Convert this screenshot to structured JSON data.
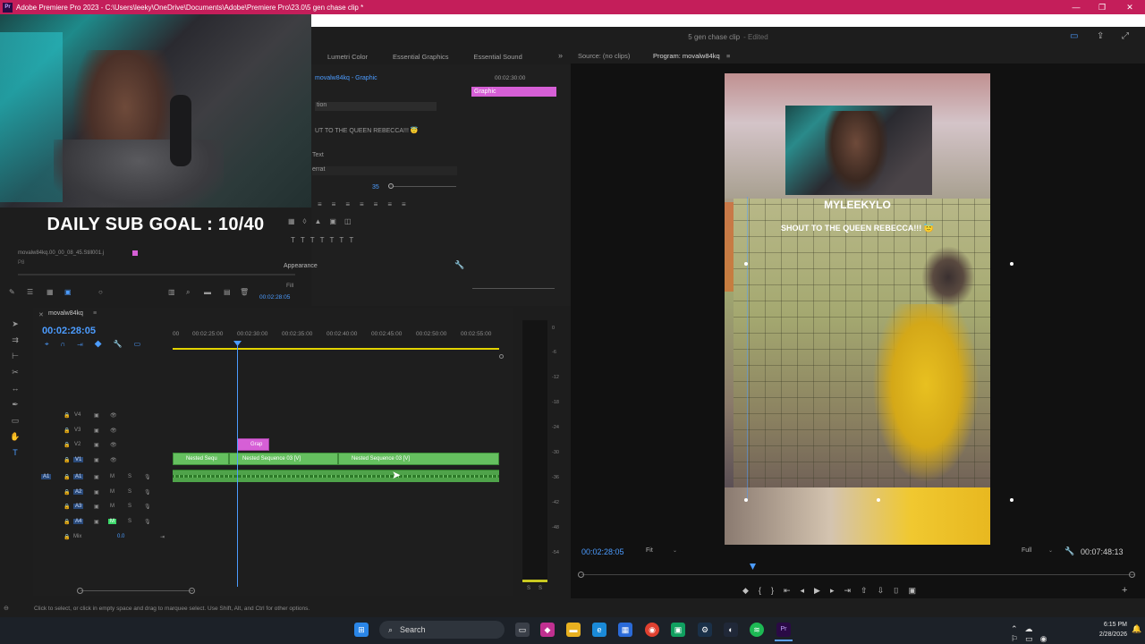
{
  "window": {
    "app_badge": "Pr",
    "title": "Adobe Premiere Pro 2023 - C:\\Users\\leeky\\OneDrive\\Documents\\Adobe\\Premiere Pro\\23.0\\5 gen chase clip *",
    "controls": [
      "—",
      "❐",
      "✕"
    ]
  },
  "document": {
    "name": "5 gen chase clip",
    "state": "- Edited"
  },
  "overlay": {
    "sub_goal": "DAILY SUB GOAL : 10/40"
  },
  "media": {
    "source_label": "movalw84kq.00_00_08_45.Still001.j",
    "source_sub": "P8"
  },
  "effect_tabs": [
    "Lumetri Color",
    "Essential Graphics",
    "Essential Sound"
  ],
  "effect_controls": {
    "header": "movalw84kq - Graphic",
    "timecode": "00:02:30:00",
    "clip_label": "Graphic",
    "rows": [
      "tion",
      "UT TO THE QUEEN REBECCA!!! 😇",
      "Text",
      "errat",
      "35"
    ],
    "appearance": "Appearance",
    "fill": "Fill",
    "current_tc": "00:02:28:05"
  },
  "timeline": {
    "sequence_name": "movalw84kq",
    "timecode": "00:02:28:05",
    "ruler": [
      "00",
      "00:02:25:00",
      "00:02:30:00",
      "00:02:35:00",
      "00:02:40:00",
      "00:02:45:00",
      "00:02:50:00",
      "00:02:55:00"
    ],
    "video_tracks": [
      "V4",
      "V3",
      "V2",
      "V1"
    ],
    "audio_tracks": [
      "A1",
      "A2",
      "A3",
      "A4"
    ],
    "mix_label": "Mix",
    "mix_value": "0.0",
    "clip_graphic": "Grap",
    "clip_v1_a": "Nested Sequ",
    "clip_v1_b": "Nested Sequence 03 [V]",
    "clip_v1_c": "Nested Sequence 03 [V]",
    "track_buttons": {
      "mute": "M",
      "solo": "S"
    }
  },
  "meters": [
    "0",
    "-6",
    "-12",
    "-18",
    "-24",
    "-30",
    "-36",
    "-42",
    "-48",
    "-54"
  ],
  "meter_footer": [
    "S",
    "S"
  ],
  "source_tab": "Source: (no clips)",
  "program": {
    "tab": "Program: movalw84kq",
    "timecode": "00:02:28:05",
    "fit": "Fit",
    "resolution": "Full",
    "duration": "00:07:48:13",
    "frame_text_name": "MYLEEKYLO",
    "frame_text_shout": "SHOUT TO THE QUEEN REBECCA!!! 😇"
  },
  "status": {
    "hint": "Click to select, or click in empty space and drag to marquee select. Use Shift, Alt, and Ctrl for other options."
  },
  "taskbar": {
    "search": "Search",
    "time": "6:15 PM",
    "date": "2/28/2026"
  },
  "colors": {
    "accent": "#4c9cff",
    "titlebar": "#c41e5a",
    "clip_green": "#65c05f",
    "graphic_pink": "#d65fd6"
  }
}
